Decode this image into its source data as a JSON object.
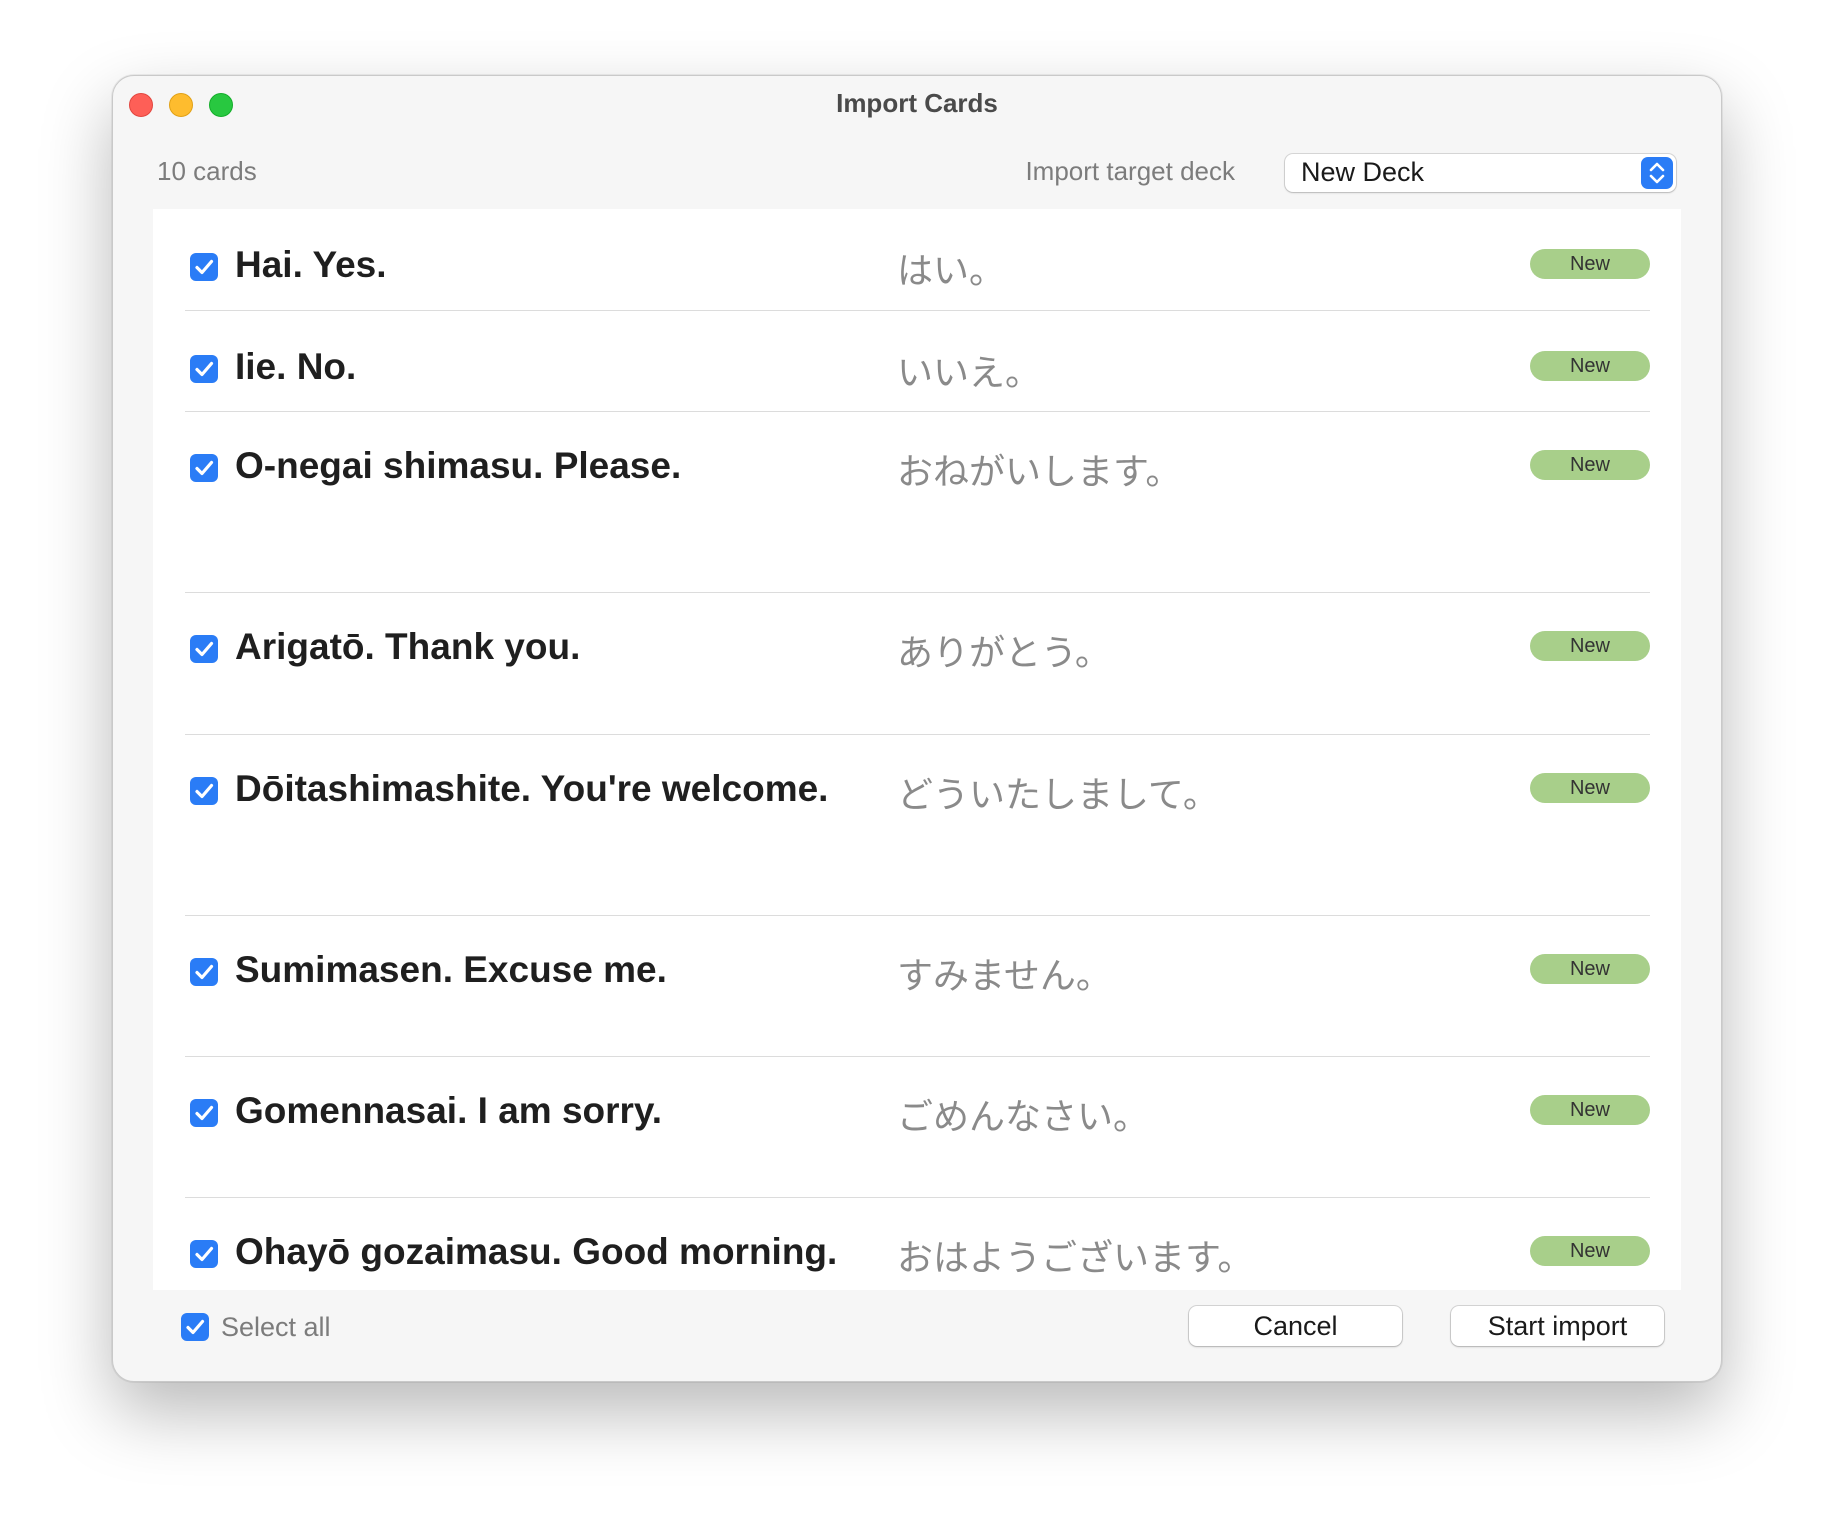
{
  "window": {
    "title": "Import Cards"
  },
  "header": {
    "card_count": "10 cards",
    "target_label": "Import target deck",
    "target_deck": "New Deck"
  },
  "cards": [
    {
      "front": "Hai. Yes.",
      "back": "はい。",
      "status": "New",
      "checked": true
    },
    {
      "front": "Iie. No.",
      "back": "いいえ。",
      "status": "New",
      "checked": true
    },
    {
      "front": "O-negai shimasu. Please.",
      "back": "おねがいします。",
      "status": "New",
      "checked": true
    },
    {
      "front": "Arigatō. Thank you.",
      "back": "ありがとう。",
      "status": "New",
      "checked": true
    },
    {
      "front": "Dōitashimashite. You're welcome.",
      "back": "どういたしまして。",
      "status": "New",
      "checked": true
    },
    {
      "front": "Sumimasen. Excuse me.",
      "back": "すみません。",
      "status": "New",
      "checked": true
    },
    {
      "front": "Gomennasai. I am sorry.",
      "back": "ごめんなさい。",
      "status": "New",
      "checked": true
    },
    {
      "front": "Ohayō gozaimasu. Good morning.",
      "back": "おはようございます。",
      "status": "New",
      "checked": true
    }
  ],
  "footer": {
    "select_all_label": "Select all",
    "select_all_checked": true,
    "cancel_label": "Cancel",
    "start_label": "Start import"
  },
  "colors": {
    "accent": "#2a7cf6",
    "badge": "#a8cf8a"
  }
}
